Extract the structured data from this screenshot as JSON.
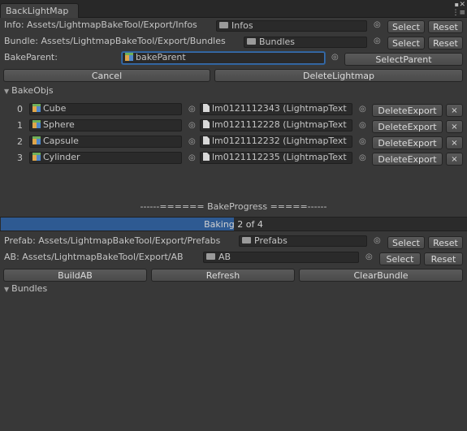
{
  "window": {
    "tab_title": "BackLightMap",
    "close_glyph": "✕",
    "menu_glyph": "⋮≡"
  },
  "info": {
    "label": "Info: Assets/LightmapBakeTool/Export/Infos",
    "field_value": "Infos",
    "select_label": "Select",
    "reset_label": "Reset"
  },
  "bundle": {
    "label": "Bundle: Assets/LightmapBakeTool/Export/Bundles",
    "field_value": "Bundles",
    "select_label": "Select",
    "reset_label": "Reset"
  },
  "bake_parent": {
    "label": "BakeParent:",
    "field_value": "bakeParent",
    "select_label": "SelectParent"
  },
  "actions": {
    "cancel_label": "Cancel",
    "delete_lightmap_label": "DeleteLightmap"
  },
  "bake_objs": {
    "header": "BakeObjs",
    "delete_export_label": "DeleteExport",
    "remove_glyph": "×",
    "items": [
      {
        "index": "0",
        "name": "Cube",
        "lightmap": "lm0121112343 (LightmapText"
      },
      {
        "index": "1",
        "name": "Sphere",
        "lightmap": "lm0121112228 (LightmapText"
      },
      {
        "index": "2",
        "name": "Capsule",
        "lightmap": "lm0121112232 (LightmapText"
      },
      {
        "index": "3",
        "name": "Cylinder",
        "lightmap": "lm0121112235 (LightmapText"
      }
    ]
  },
  "progress": {
    "title": "------====== BakeProgress =====------",
    "text": "Baking 2 of 4",
    "fraction": 0.5,
    "fill_color": "#2e5a92"
  },
  "prefab": {
    "label": "Prefab: Assets/LightmapBakeTool/Export/Prefabs",
    "field_value": "Prefabs",
    "select_label": "Select",
    "reset_label": "Reset"
  },
  "ab": {
    "label": "AB: Assets/LightmapBakeTool/Export/AB",
    "field_value": "AB",
    "select_label": "Select",
    "reset_label": "Reset"
  },
  "bottom_actions": {
    "build_ab_label": "BuildAB",
    "refresh_label": "Refresh",
    "clear_bundle_label": "ClearBundle"
  },
  "bundles": {
    "header": "Bundles"
  },
  "icons": {
    "picker": "object-picker-icon",
    "folder": "folder-icon",
    "gameobject": "cube-icon",
    "texture": "document-icon"
  }
}
